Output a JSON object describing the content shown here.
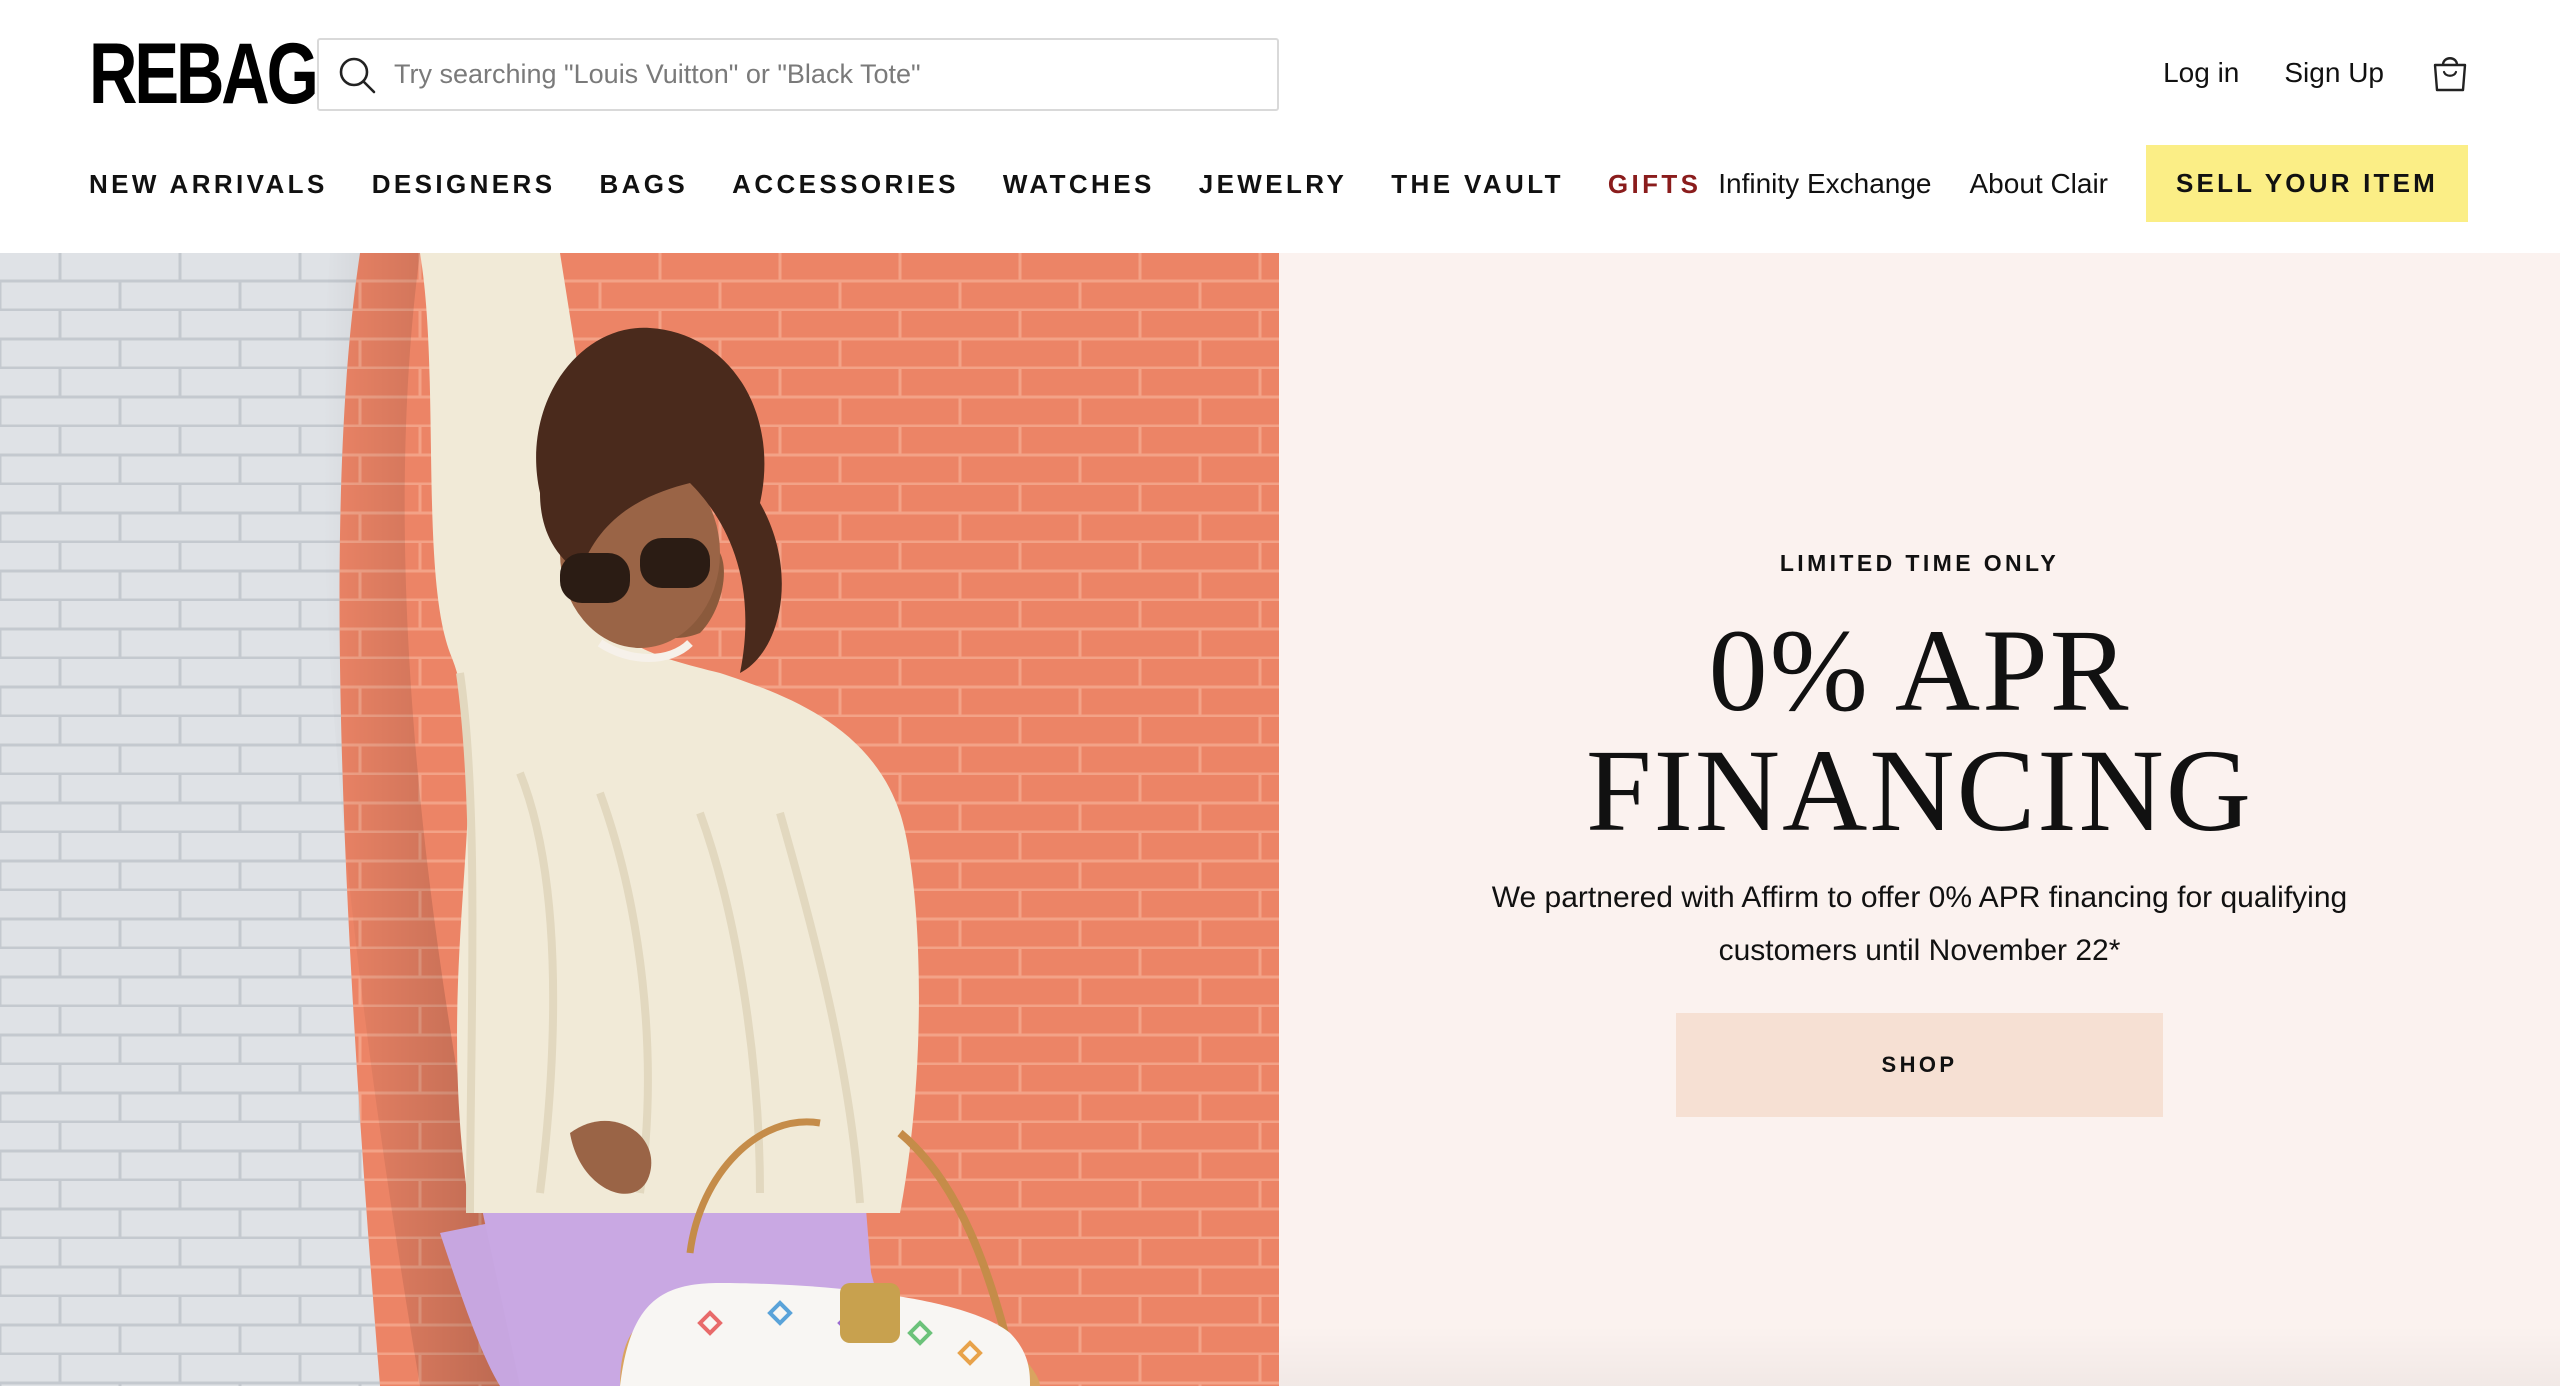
{
  "header": {
    "logo_text": "REBAG",
    "search": {
      "placeholder": "Try searching \"Louis Vuitton\" or \"Black Tote\"",
      "icon": "search-icon"
    },
    "account": {
      "login_label": "Log in",
      "signup_label": "Sign Up",
      "cart_icon": "shopping-bag-icon"
    }
  },
  "nav": {
    "main": [
      {
        "label": "NEW ARRIVALS"
      },
      {
        "label": "DESIGNERS"
      },
      {
        "label": "BAGS"
      },
      {
        "label": "ACCESSORIES"
      },
      {
        "label": "WATCHES"
      },
      {
        "label": "JEWELRY"
      },
      {
        "label": "THE VAULT"
      },
      {
        "label": "GIFTS"
      }
    ],
    "secondary": [
      {
        "label": "Infinity Exchange"
      },
      {
        "label": "About Clair"
      }
    ],
    "sell_label": "SELL YOUR ITEM"
  },
  "hero": {
    "eyebrow": "LIMITED TIME ONLY",
    "headline_line1": "0% APR",
    "headline_line2": "FINANCING",
    "subcopy": "We partnered with Affirm to offer 0% APR financing for qualifying customers until November 22*",
    "cta_label": "SHOP"
  },
  "colors": {
    "gifts_accent": "#8a1c1c",
    "sell_button_bg": "#fbee86",
    "hero_panel_bg": "#fbf2ef",
    "shop_button_bg": "#f6e0d3",
    "brick_orange": "#ec8466",
    "brick_white": "#dfe2e6"
  }
}
